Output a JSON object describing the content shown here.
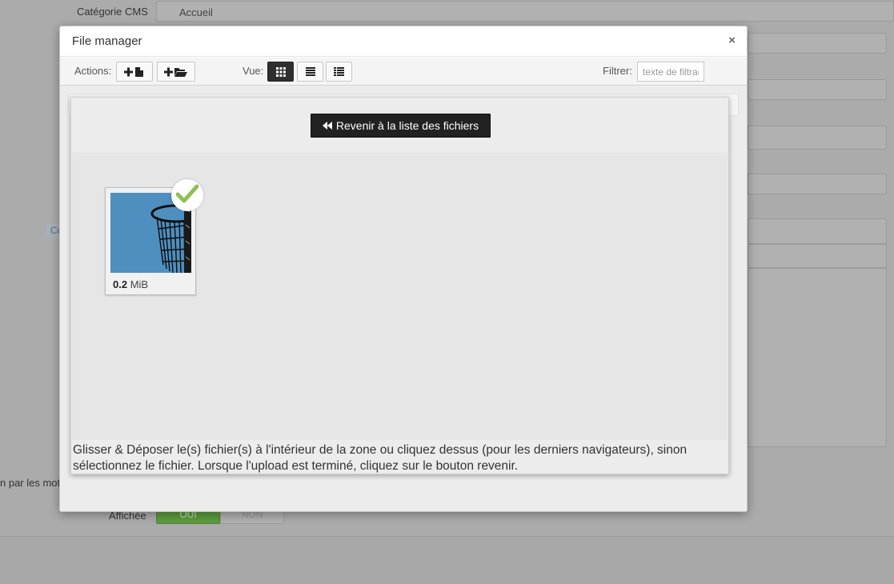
{
  "background_page": {
    "category_label": "Catégorie CMS",
    "category_value": "Accueil",
    "truncated_tag": "Co",
    "truncated_text": "n par les mot",
    "displayed_label": "Affichée",
    "toggle_on": "OUI",
    "toggle_off": "NON"
  },
  "modal": {
    "title": "File manager",
    "close_label": "×",
    "toolbar": {
      "actions_label": "Actions:",
      "view_label": "Vue:",
      "filter_label": "Filtrer:",
      "filter_placeholder": "texte de filtrage",
      "active_view": "grid"
    },
    "upload": {
      "back_button_label": "Revenir à la liste des fichiers",
      "file": {
        "size_value": "0.2",
        "size_unit": "MiB",
        "status": "uploaded"
      },
      "help_text": "Glisser & Déposer le(s) fichier(s) à l'intérieur de la zone ou cliquez dessus (pour les derniers navigateurs), sinon sélectionnez le fichier. Lorsque l'upload est terminé, cliquez sur le bouton revenir."
    }
  },
  "colors": {
    "overlay": "#ababab",
    "active_button": "#2f2f2f",
    "back_button": "#222222",
    "check": "#8cc152",
    "thumbnail_sky": "#4e8fbf",
    "toggle_on": "#5c9b3e"
  },
  "icons": {
    "add_file": "plus-file-icon",
    "add_folder": "plus-folder-icon",
    "view_grid": "grid-icon",
    "view_list": "list-icon",
    "view_details": "columns-icon",
    "back": "double-chevron-left-icon",
    "check": "check-icon",
    "close": "close-icon"
  }
}
